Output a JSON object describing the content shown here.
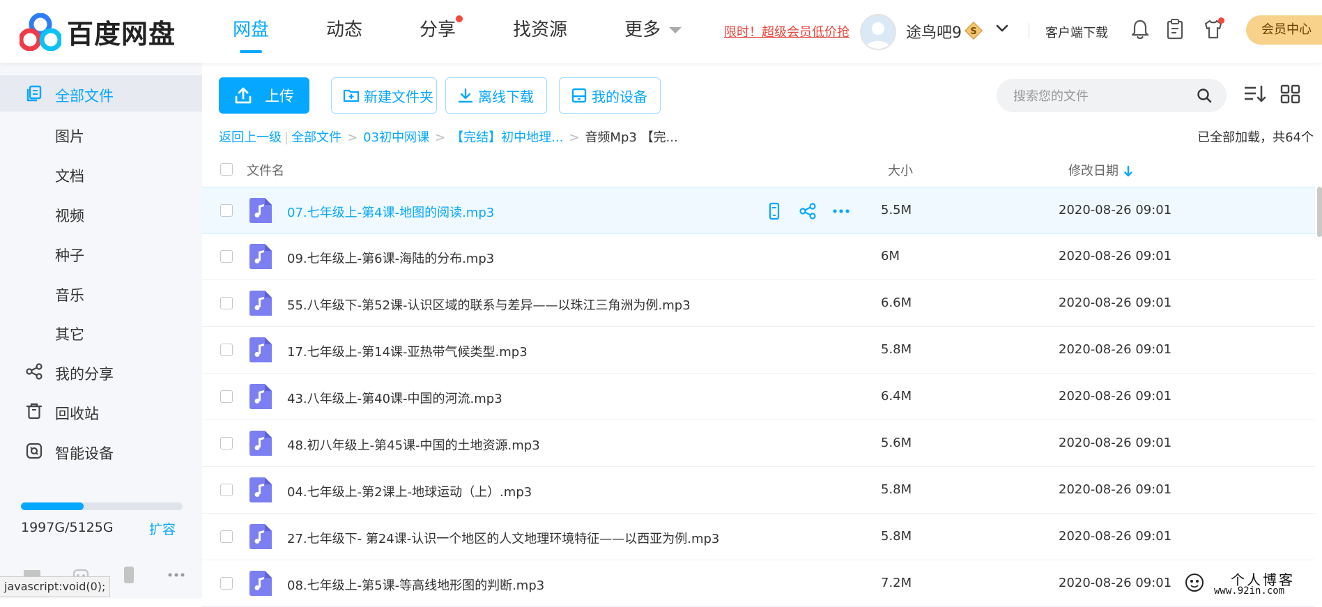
{
  "app": {
    "logo_text": "百度网盘",
    "brand_colors": {
      "accent": "#06a7ff",
      "red": "#f5483b",
      "gold": "#f8d28a"
    }
  },
  "nav": [
    {
      "label": "网盘",
      "active": true
    },
    {
      "label": "动态"
    },
    {
      "label": "分享",
      "dot": true
    },
    {
      "label": "找资源"
    },
    {
      "label": "更多",
      "caret": true
    }
  ],
  "header": {
    "promo": "限时！超级会员低价抢",
    "username": "途鸟吧9",
    "vip_badge_letter": "S",
    "client_download": "客户端下载",
    "member_center": "会员中心",
    "icons": [
      "bell-icon",
      "clipboard-icon",
      "tshirt-icon"
    ]
  },
  "sidebar": {
    "items": [
      {
        "label": "全部文件",
        "icon": "files-icon",
        "active": true
      },
      {
        "label": "图片"
      },
      {
        "label": "文档"
      },
      {
        "label": "视频"
      },
      {
        "label": "种子"
      },
      {
        "label": "音乐"
      },
      {
        "label": "其它"
      },
      {
        "label": "我的分享",
        "icon": "share-icon"
      },
      {
        "label": "回收站",
        "icon": "trash-icon"
      },
      {
        "label": "智能设备",
        "icon": "device-icon"
      }
    ],
    "storage": {
      "used_fraction": 0.39,
      "text": "1997G/5125G",
      "expand": "扩容"
    },
    "status_url": "javascript:void(0);"
  },
  "toolbar": {
    "upload": "上传",
    "new_folder": "新建文件夹",
    "offline_download": "离线下载",
    "my_devices": "我的设备",
    "search_placeholder": "搜索您的文件"
  },
  "breadcrumb": {
    "back": "返回上一级",
    "items": [
      "全部文件",
      "03初中网课",
      "【完结】初中地理..."
    ],
    "current": "音频Mp3 【完...",
    "loaded_info": "已全部加载，共64个"
  },
  "table": {
    "headers": {
      "name": "文件名",
      "size": "大小",
      "date": "修改日期"
    },
    "rows": [
      {
        "name": "07.七年级上-第4课-地图的阅读.mp3",
        "size": "5.5M",
        "date": "2020-08-26 09:01"
      },
      {
        "name": "09.七年级上-第6课-海陆的分布.mp3",
        "size": "6M",
        "date": "2020-08-26 09:01"
      },
      {
        "name": "55.八年级下-第52课-认识区域的联系与差异——以珠江三角洲为例.mp3",
        "size": "6.6M",
        "date": "2020-08-26 09:01"
      },
      {
        "name": "17.七年级上-第14课-亚热带气候类型.mp3",
        "size": "5.8M",
        "date": "2020-08-26 09:01"
      },
      {
        "name": "43.八年级上-第40课-中国的河流.mp3",
        "size": "6.4M",
        "date": "2020-08-26 09:01"
      },
      {
        "name": "48.初八年级上-第45课-中国的土地资源.mp3",
        "size": "5.6M",
        "date": "2020-08-26 09:01"
      },
      {
        "name": "04.七年级上-第2课上-地球运动（上）.mp3",
        "size": "5.8M",
        "date": "2020-08-26 09:01"
      },
      {
        "name": "27.七年级下- 第24课-认识一个地区的人文地理环境特征——以西亚为例.mp3",
        "size": "5.8M",
        "date": "2020-08-26 09:01"
      },
      {
        "name": "08.七年级上-第5课-等高线地形图的判断.mp3",
        "size": "7.2M",
        "date": "2020-08-26 09:01"
      }
    ]
  },
  "watermark": {
    "title": "个人博客",
    "url": "www.92in.com"
  }
}
